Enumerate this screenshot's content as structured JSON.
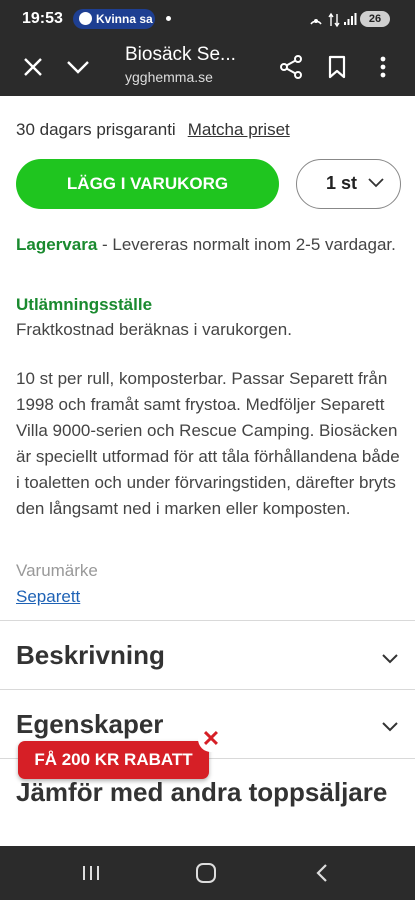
{
  "status_bar": {
    "time": "19:53",
    "notification_pill": "Kvinna sa",
    "battery": "26"
  },
  "browser": {
    "title": "Biosäck Se...",
    "url": "ygghemma.se"
  },
  "product": {
    "price_guarantee": "30 dagars prisgaranti",
    "match_price": "Matcha priset",
    "add_to_cart": "LÄGG I VARUKORG",
    "quantity": "1 st",
    "stock_label": "Lagervara",
    "stock_text": "- Levereras normalt inom 2-5 vardagar.",
    "pickup_title": "Utlämningsställe",
    "pickup_text": "Fraktkostnad beräknas i varukorgen.",
    "description": "10 st per rull, komposterbar. Passar Separett från 1998 och framåt samt frystoa. Medföljer Separett Villa 9000-serien och Rescue Camping. Biosäcken är speciellt utformad för att tåla förhållandena både i toaletten och under förvaringstiden, därefter bryts den långsamt ned i marken eller komposten.",
    "brand_label": "Varumärke",
    "brand": "Separett"
  },
  "accordions": [
    {
      "label": "Beskrivning"
    },
    {
      "label": "Egenskaper"
    },
    {
      "label": "Jämför med andra toppsäljare"
    }
  ],
  "promo": {
    "label": "FÅ 200 KR RABATT",
    "close": "✕"
  },
  "colors": {
    "accent_green": "#1fc51f",
    "stock_green": "#1a8a2f",
    "promo_red": "#d61f26",
    "link_blue": "#1e62b5",
    "chrome": "#2b2b2b"
  }
}
